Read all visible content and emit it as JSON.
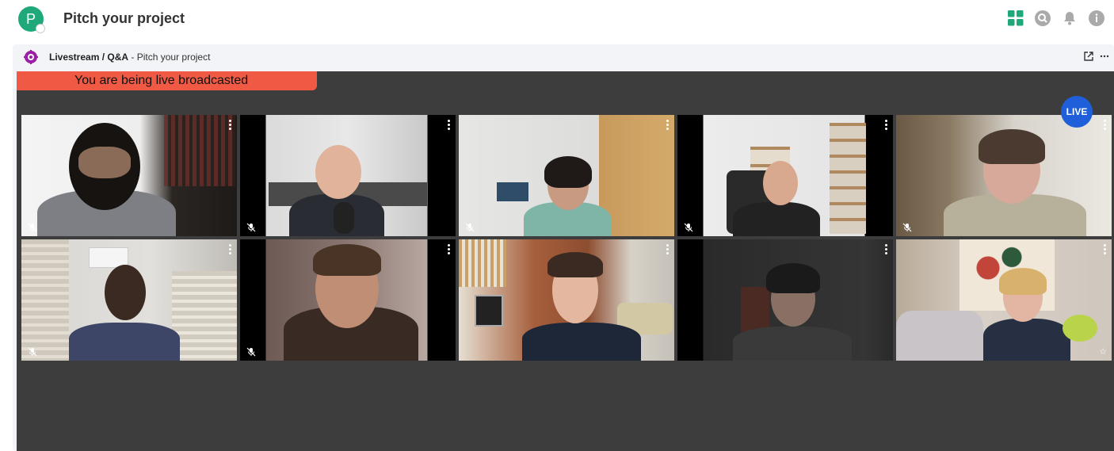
{
  "app": {
    "space_initial": "P",
    "page_title": "Pitch your project",
    "icons": [
      "apps-grid-icon",
      "search-icon",
      "bell-icon",
      "info-icon"
    ]
  },
  "panel": {
    "title_bold": "Livestream / Q&A",
    "title_rest": " - Pitch your project",
    "icons": [
      "open-external-icon",
      "more-horizontal-icon"
    ]
  },
  "stage": {
    "banner_text": "You are being live broadcasted",
    "live_badge": "LIVE"
  },
  "colors": {
    "brand_green": "#1fa97a",
    "banner_red": "#f05a45",
    "live_blue": "#1f5fd9",
    "stage_bg": "#3d3d3d"
  },
  "participants": [
    {
      "muted": true
    },
    {
      "muted": true
    },
    {
      "muted": true
    },
    {
      "muted": true
    },
    {
      "muted": true
    },
    {
      "muted": true
    },
    {
      "muted": true
    },
    {
      "muted": false
    },
    {
      "muted": false
    },
    {
      "muted": false,
      "starred": true
    }
  ]
}
